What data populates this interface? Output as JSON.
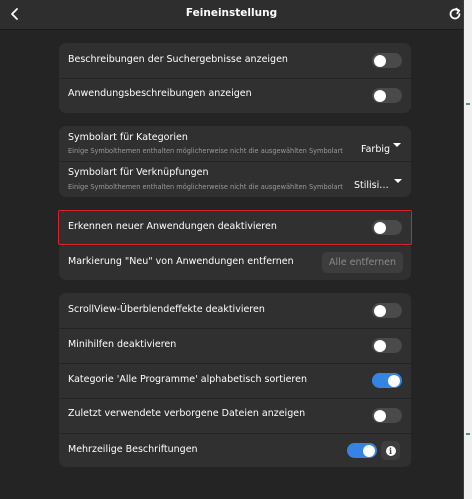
{
  "header": {
    "title": "Feineinstellung",
    "back_icon": "chevron-left-icon",
    "refresh_icon": "refresh-icon"
  },
  "group1": {
    "rows": [
      {
        "label": "Beschreibungen der Suchergebnisse anzeigen",
        "toggle": false
      },
      {
        "label": "Anwendungsbeschreibungen anzeigen",
        "toggle": false
      }
    ]
  },
  "group2": {
    "rows": [
      {
        "label": "Symbolart für Kategorien",
        "sub": "Einige Symbolthemen enthalten möglicherweise nicht die ausgewählten Symbolart",
        "value": "Farbig"
      },
      {
        "label": "Symbolart für Verknüpfungen",
        "sub": "Einige Symbolthemen enthalten möglicherweise nicht die ausgewählten Symbolart",
        "value": "Stilisi…"
      }
    ]
  },
  "group3": {
    "rows": [
      {
        "label": "Erkennen neuer Anwendungen deaktivieren",
        "toggle": false
      },
      {
        "label": "Markierung \"Neu\" von Anwendungen entfernen",
        "button": "Alle entfernen"
      }
    ]
  },
  "group4": {
    "rows": [
      {
        "label": "ScrollView-Überblendeffekte deaktivieren",
        "toggle": false
      },
      {
        "label": "Minihilfen deaktivieren",
        "toggle": false
      },
      {
        "label": "Kategorie 'Alle Programme' alphabetisch sortieren",
        "toggle": true
      },
      {
        "label": "Zuletzt verwendete verborgene Dateien anzeigen",
        "toggle": false
      },
      {
        "label": "Mehrzeilige Beschriftungen",
        "toggle": true,
        "info_icon": "info-icon"
      }
    ]
  },
  "colors": {
    "accent": "#3584e4",
    "highlight": "#d6232b",
    "background": "#242424",
    "card": "#303030"
  }
}
